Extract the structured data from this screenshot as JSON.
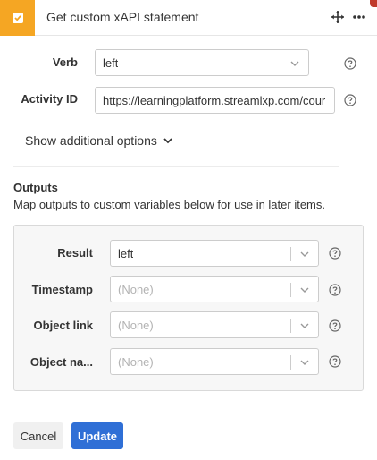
{
  "header": {
    "title": "Get custom xAPI statement",
    "badge_color": "#f5a623",
    "icons": [
      "check-icon",
      "move-icon",
      "more-icon"
    ]
  },
  "form": {
    "verb": {
      "label": "Verb",
      "value": "left"
    },
    "activity_id": {
      "label": "Activity ID",
      "value": "https://learningplatform.streamlxp.com/cour"
    },
    "show_more_label": "Show additional options"
  },
  "outputs": {
    "title": "Outputs",
    "description": "Map outputs to custom variables below for use in later items.",
    "result": {
      "label": "Result",
      "value": "left"
    },
    "timestamp": {
      "label": "Timestamp",
      "value": "(None)"
    },
    "object_link": {
      "label": "Object link",
      "value": "(None)"
    },
    "object_name": {
      "label": "Object na...",
      "value": "(None)"
    }
  },
  "buttons": {
    "cancel": "Cancel",
    "update": "Update",
    "update_color": "#2f6fd6"
  }
}
